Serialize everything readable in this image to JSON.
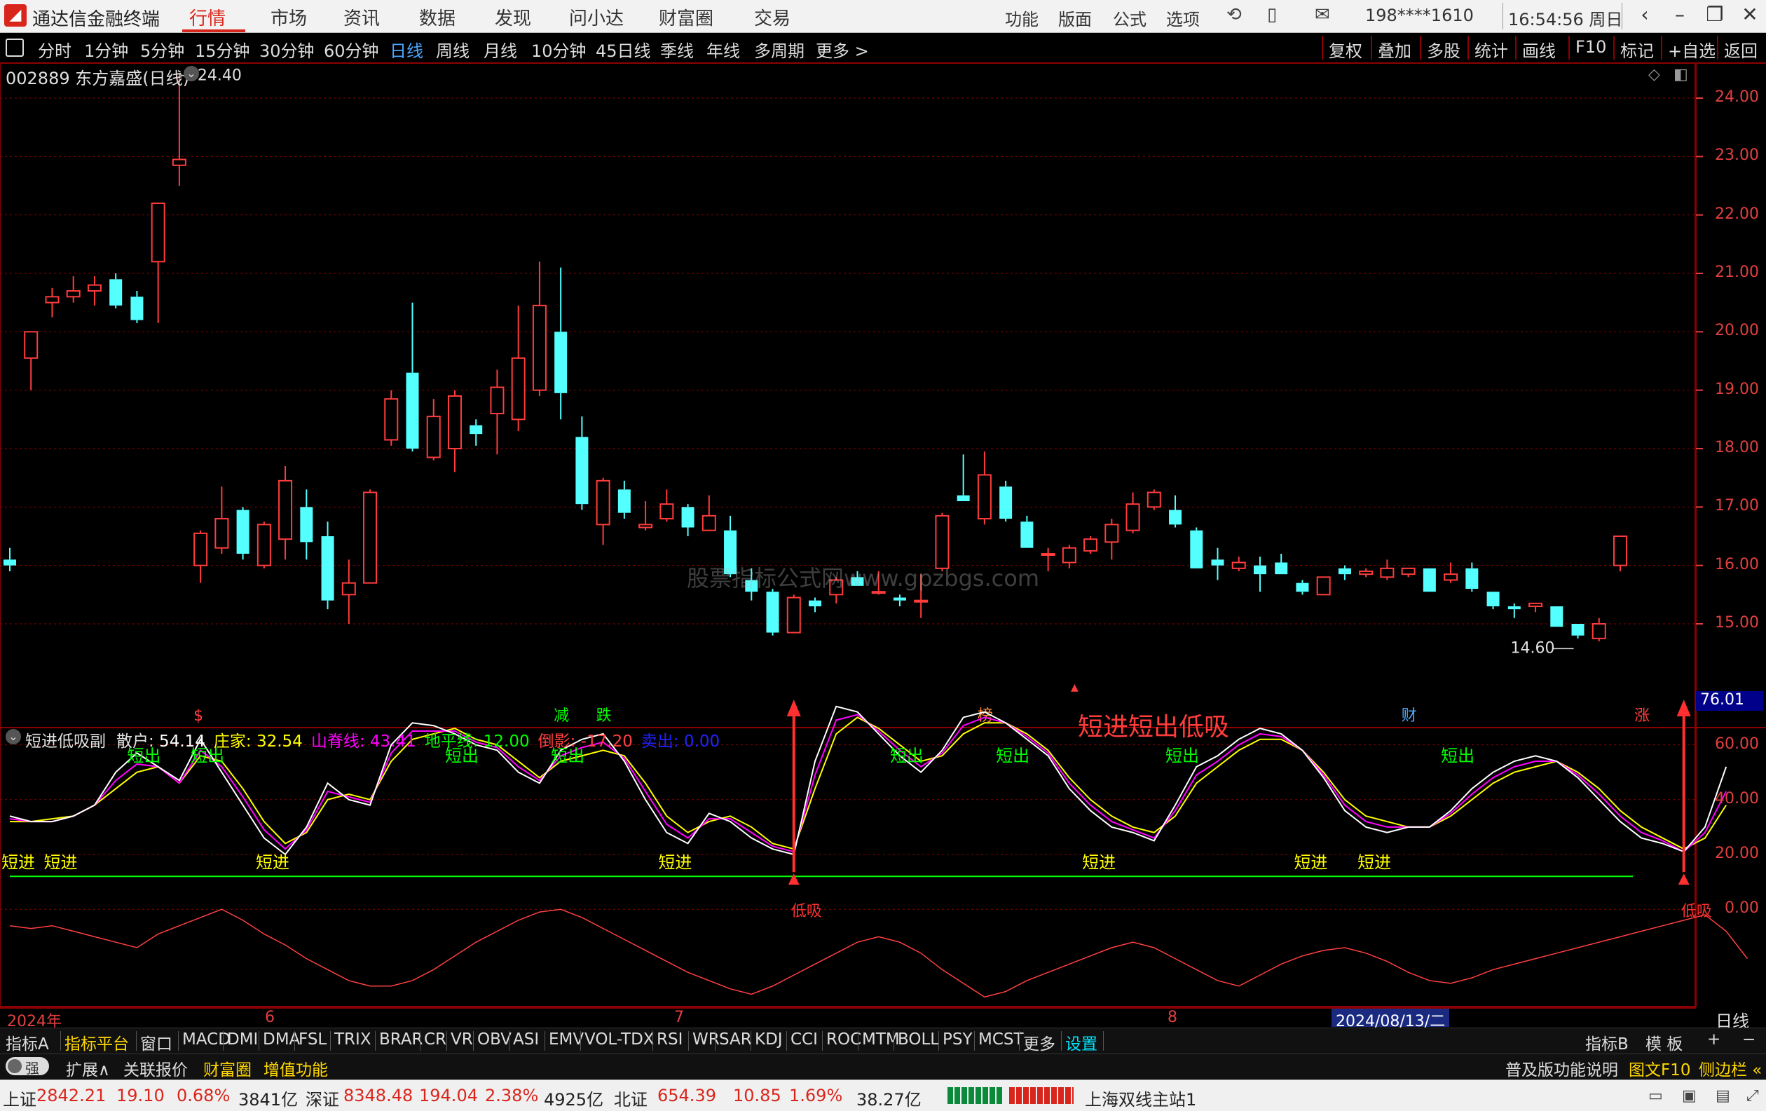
{
  "app": {
    "title": "通达信金融终端",
    "logo_icon": "tdx-logo-icon"
  },
  "menu": [
    "行情",
    "市场",
    "资讯",
    "数据",
    "发现",
    "问小达",
    "财富圈",
    "交易"
  ],
  "menu_active": "行情",
  "top_right": {
    "items": [
      "功能",
      "版面",
      "公式",
      "选项"
    ],
    "account": "198****1610",
    "clock": "16:54:56 周日"
  },
  "periods": [
    "分时",
    "1分钟",
    "5分钟",
    "15分钟",
    "30分钟",
    "60分钟",
    "日线",
    "周线",
    "月线",
    "10分钟",
    "45日线",
    "季线",
    "年线",
    "多周期",
    "更多 >"
  ],
  "period_active": "日线",
  "tools": [
    "复权",
    "叠加",
    "多股",
    "统计",
    "画线",
    "F10",
    "标记",
    "+自选",
    "返回"
  ],
  "stock": {
    "code_name": "002889 东方嘉盛(日线)",
    "high_label": "24.40",
    "low_label": "14.60"
  },
  "price_axis": [
    "24.00",
    "23.00",
    "22.00",
    "21.00",
    "20.00",
    "19.00",
    "18.00",
    "17.00",
    "16.00",
    "15.00"
  ],
  "sub_axis": [
    "60.00",
    "40.00",
    "20.00",
    "0.00"
  ],
  "sub_current": "76.01",
  "watermark": "股票指标公式网www.gpzbgs.com",
  "annotation": "短进短出低吸",
  "event_marks": [
    {
      "text": "$",
      "color": "#ff4040"
    },
    {
      "text": "减",
      "color": "#00ff00"
    },
    {
      "text": "跌",
      "color": "#00ff00"
    },
    {
      "text": "榜",
      "color": "#ff8c3c"
    },
    {
      "text": "财",
      "color": "#4da6ff"
    },
    {
      "text": "涨",
      "color": "#ff4040"
    }
  ],
  "indicator": {
    "name": "短进低吸副",
    "values": [
      {
        "label": "散户:",
        "value": "54.14",
        "color": "#ffffff"
      },
      {
        "label": "庄家:",
        "value": "32.54",
        "color": "#ffff00"
      },
      {
        "label": "山脊线:",
        "value": "43.41",
        "color": "#ff00ff"
      },
      {
        "label": "地平线:",
        "value": "12.00",
        "color": "#00ff00"
      },
      {
        "label": "倒影:",
        "value": "-17.20",
        "color": "#ff4040"
      },
      {
        "label": "卖出:",
        "value": "0.00",
        "color": "#2222ff"
      }
    ],
    "signal_in": "短进",
    "signal_out": "短出",
    "signal_low": "低吸"
  },
  "date_axis": [
    "2024年",
    "6",
    "7",
    "8"
  ],
  "date_cursor": "2024/08/13/二",
  "period_label_right": "日线",
  "indicator_tabs": [
    "指标A",
    "指标平台",
    "窗口",
    "MACD",
    "DMI",
    "DMA",
    "FSL",
    "TRIX",
    "BRAR",
    "CR",
    "VR",
    "OBV",
    "ASI",
    "EMV",
    "VOL-TDX",
    "RSI",
    "WR",
    "SAR",
    "KDJ",
    "CCI",
    "ROC",
    "MTM",
    "BOLL",
    "PSY",
    "MCST",
    "更多",
    "设置"
  ],
  "indicator_tabs_right": [
    "指标B",
    "模 板",
    "+",
    "−"
  ],
  "ext_bar": {
    "toggle": "强",
    "items": [
      "扩展∧",
      "关联报价",
      "财富圈",
      "增值功能"
    ],
    "right": [
      "普及版功能说明",
      "图文F10",
      "侧边栏 «"
    ]
  },
  "status": {
    "sh": {
      "name": "上证",
      "price": "2842.21",
      "chg": "19.10",
      "pct": "0.68%",
      "amt": "3841亿"
    },
    "sz": {
      "name": "深证",
      "price": "8348.48",
      "chg": "194.04",
      "pct": "2.38%",
      "amt": "4925亿"
    },
    "bz": {
      "name": "北证",
      "price": "654.39",
      "chg": "10.85",
      "pct": "1.69%",
      "amt": "38.27亿"
    },
    "server": "上海双线主站1"
  },
  "colors": {
    "up": "#ff3c3c",
    "down": "#54ffff",
    "grid": "#8b0000",
    "axis": "#e04040"
  },
  "chart_data": {
    "type": "candlestick",
    "title": "002889 东方嘉盛(日线)",
    "ylim": [
      14.4,
      24.6
    ],
    "candles": [
      {
        "o": 16.1,
        "h": 16.3,
        "l": 15.9,
        "c": 16.0
      },
      {
        "o": 19.55,
        "h": 19.8,
        "l": 19.0,
        "c": 20.0
      },
      {
        "o": 20.5,
        "h": 20.75,
        "l": 20.25,
        "c": 20.6
      },
      {
        "o": 20.6,
        "h": 20.95,
        "l": 20.5,
        "c": 20.7
      },
      {
        "o": 20.7,
        "h": 20.95,
        "l": 20.45,
        "c": 20.8
      },
      {
        "o": 20.9,
        "h": 21.0,
        "l": 20.4,
        "c": 20.45
      },
      {
        "o": 20.6,
        "h": 20.7,
        "l": 20.15,
        "c": 20.2
      },
      {
        "o": 21.2,
        "h": 22.2,
        "l": 20.15,
        "c": 22.2
      },
      {
        "o": 22.85,
        "h": 24.4,
        "l": 22.5,
        "c": 22.95
      },
      {
        "o": 16.0,
        "h": 16.6,
        "l": 15.7,
        "c": 16.55
      },
      {
        "o": 16.3,
        "h": 17.35,
        "l": 16.2,
        "c": 16.8
      },
      {
        "o": 16.95,
        "h": 17.0,
        "l": 16.1,
        "c": 16.2
      },
      {
        "o": 16.0,
        "h": 16.75,
        "l": 15.95,
        "c": 16.7
      },
      {
        "o": 16.45,
        "h": 17.7,
        "l": 16.1,
        "c": 17.45
      },
      {
        "o": 17.0,
        "h": 17.3,
        "l": 16.1,
        "c": 16.4
      },
      {
        "o": 16.5,
        "h": 16.75,
        "l": 15.25,
        "c": 15.4
      },
      {
        "o": 15.5,
        "h": 16.1,
        "l": 15.0,
        "c": 15.7
      },
      {
        "o": 15.7,
        "h": 17.3,
        "l": 15.7,
        "c": 17.25
      },
      {
        "o": 18.15,
        "h": 19.0,
        "l": 18.05,
        "c": 18.85
      },
      {
        "o": 19.3,
        "h": 20.5,
        "l": 17.95,
        "c": 18.0
      },
      {
        "o": 17.85,
        "h": 18.85,
        "l": 17.8,
        "c": 18.55
      },
      {
        "o": 18.0,
        "h": 19.0,
        "l": 17.6,
        "c": 18.9
      },
      {
        "o": 18.4,
        "h": 18.5,
        "l": 18.05,
        "c": 18.25
      },
      {
        "o": 18.6,
        "h": 19.35,
        "l": 17.9,
        "c": 19.05
      },
      {
        "o": 18.5,
        "h": 20.45,
        "l": 18.3,
        "c": 19.55
      },
      {
        "o": 19.0,
        "h": 21.2,
        "l": 18.9,
        "c": 20.45
      },
      {
        "o": 20.0,
        "h": 21.1,
        "l": 18.5,
        "c": 18.95
      },
      {
        "o": 18.2,
        "h": 18.55,
        "l": 16.95,
        "c": 17.05
      },
      {
        "o": 16.7,
        "h": 17.5,
        "l": 16.35,
        "c": 17.45
      },
      {
        "o": 17.3,
        "h": 17.45,
        "l": 16.8,
        "c": 16.9
      },
      {
        "o": 16.65,
        "h": 17.1,
        "l": 16.6,
        "c": 16.7
      },
      {
        "o": 16.8,
        "h": 17.3,
        "l": 16.75,
        "c": 17.05
      },
      {
        "o": 17.0,
        "h": 17.05,
        "l": 16.5,
        "c": 16.65
      },
      {
        "o": 16.6,
        "h": 17.2,
        "l": 16.6,
        "c": 16.85
      },
      {
        "o": 16.6,
        "h": 16.85,
        "l": 15.8,
        "c": 15.85
      },
      {
        "o": 15.75,
        "h": 15.95,
        "l": 15.4,
        "c": 15.55
      },
      {
        "o": 15.55,
        "h": 15.6,
        "l": 14.8,
        "c": 14.85
      },
      {
        "o": 14.85,
        "h": 15.5,
        "l": 14.85,
        "c": 15.45
      },
      {
        "o": 15.4,
        "h": 15.45,
        "l": 15.2,
        "c": 15.3
      },
      {
        "o": 15.5,
        "h": 15.8,
        "l": 15.35,
        "c": 15.75
      },
      {
        "o": 15.8,
        "h": 15.9,
        "l": 15.65,
        "c": 15.65
      },
      {
        "o": 15.55,
        "h": 15.9,
        "l": 15.5,
        "c": 15.55
      },
      {
        "o": 15.45,
        "h": 15.5,
        "l": 15.3,
        "c": 15.4
      },
      {
        "o": 15.4,
        "h": 15.85,
        "l": 15.1,
        "c": 15.4
      },
      {
        "o": 15.95,
        "h": 16.9,
        "l": 15.9,
        "c": 16.85
      },
      {
        "o": 17.2,
        "h": 17.9,
        "l": 17.1,
        "c": 17.1
      },
      {
        "o": 16.8,
        "h": 17.95,
        "l": 16.7,
        "c": 17.55
      },
      {
        "o": 17.35,
        "h": 17.45,
        "l": 16.75,
        "c": 16.8
      },
      {
        "o": 16.75,
        "h": 16.85,
        "l": 16.3,
        "c": 16.3
      },
      {
        "o": 16.2,
        "h": 16.3,
        "l": 15.9,
        "c": 16.2
      },
      {
        "o": 16.05,
        "h": 16.35,
        "l": 15.95,
        "c": 16.3
      },
      {
        "o": 16.25,
        "h": 16.5,
        "l": 16.2,
        "c": 16.45
      },
      {
        "o": 16.4,
        "h": 16.8,
        "l": 16.1,
        "c": 16.7
      },
      {
        "o": 16.6,
        "h": 17.25,
        "l": 16.55,
        "c": 17.05
      },
      {
        "o": 17.0,
        "h": 17.3,
        "l": 16.95,
        "c": 17.25
      },
      {
        "o": 16.95,
        "h": 17.2,
        "l": 16.65,
        "c": 16.7
      },
      {
        "o": 16.6,
        "h": 16.65,
        "l": 15.95,
        "c": 15.95
      },
      {
        "o": 16.1,
        "h": 16.3,
        "l": 15.75,
        "c": 16.0
      },
      {
        "o": 15.95,
        "h": 16.15,
        "l": 15.9,
        "c": 16.05
      },
      {
        "o": 16.0,
        "h": 16.15,
        "l": 15.55,
        "c": 15.85
      },
      {
        "o": 16.05,
        "h": 16.2,
        "l": 15.85,
        "c": 15.85
      },
      {
        "o": 15.7,
        "h": 15.75,
        "l": 15.5,
        "c": 15.55
      },
      {
        "o": 15.5,
        "h": 15.8,
        "l": 15.5,
        "c": 15.8
      },
      {
        "o": 15.95,
        "h": 16.0,
        "l": 15.75,
        "c": 15.85
      },
      {
        "o": 15.85,
        "h": 15.95,
        "l": 15.8,
        "c": 15.9
      },
      {
        "o": 15.8,
        "h": 16.1,
        "l": 15.75,
        "c": 15.95
      },
      {
        "o": 15.85,
        "h": 15.95,
        "l": 15.8,
        "c": 15.95
      },
      {
        "o": 15.95,
        "h": 15.95,
        "l": 15.55,
        "c": 15.55
      },
      {
        "o": 15.75,
        "h": 16.05,
        "l": 15.7,
        "c": 15.85
      },
      {
        "o": 15.95,
        "h": 16.05,
        "l": 15.55,
        "c": 15.6
      },
      {
        "o": 15.55,
        "h": 15.55,
        "l": 15.25,
        "c": 15.3
      },
      {
        "o": 15.3,
        "h": 15.35,
        "l": 15.1,
        "c": 15.25
      },
      {
        "o": 15.3,
        "h": 15.35,
        "l": 15.2,
        "c": 15.35
      },
      {
        "o": 15.3,
        "h": 15.3,
        "l": 14.95,
        "c": 14.95
      },
      {
        "o": 15.0,
        "h": 15.0,
        "l": 14.75,
        "c": 14.8
      },
      {
        "o": 14.75,
        "h": 15.1,
        "l": 14.7,
        "c": 15.0
      },
      {
        "o": 16.0,
        "h": 16.5,
        "l": 15.9,
        "c": 16.5
      }
    ],
    "sub": {
      "ylim": [
        -14,
        76
      ],
      "retail": [
        34,
        32,
        32,
        34,
        38,
        50,
        57,
        52,
        47,
        62,
        50,
        38,
        26,
        20,
        30,
        46,
        40,
        38,
        60,
        68,
        67,
        64,
        60,
        58,
        50,
        46,
        58,
        62,
        64,
        54,
        40,
        28,
        24,
        35,
        32,
        26,
        22,
        20,
        54,
        74,
        72,
        64,
        56,
        50,
        58,
        70,
        72,
        68,
        62,
        56,
        44,
        36,
        30,
        28,
        25,
        38,
        52,
        56,
        62,
        66,
        64,
        58,
        48,
        36,
        30,
        28,
        30,
        30,
        36,
        44,
        50,
        54,
        56,
        54,
        48,
        40,
        32,
        26,
        24,
        21,
        30,
        52
      ],
      "whale": [
        32,
        32,
        33,
        34,
        38,
        44,
        50,
        52,
        46,
        56,
        54,
        44,
        32,
        24,
        28,
        40,
        42,
        40,
        54,
        62,
        64,
        66,
        62,
        60,
        54,
        48,
        54,
        56,
        58,
        56,
        46,
        34,
        28,
        32,
        34,
        30,
        24,
        22,
        44,
        64,
        70,
        66,
        60,
        54,
        56,
        64,
        68,
        68,
        64,
        58,
        48,
        40,
        34,
        30,
        28,
        34,
        46,
        52,
        58,
        62,
        62,
        58,
        50,
        40,
        34,
        32,
        30,
        30,
        34,
        40,
        46,
        50,
        52,
        54,
        50,
        44,
        36,
        30,
        26,
        22,
        26,
        38
      ],
      "ridge": [
        33,
        32,
        32,
        34,
        38,
        47,
        53,
        52,
        46,
        58,
        52,
        41,
        29,
        22,
        29,
        43,
        41,
        39,
        57,
        65,
        65,
        65,
        61,
        59,
        52,
        47,
        56,
        59,
        61,
        55,
        43,
        31,
        26,
        33,
        33,
        28,
        23,
        21,
        49,
        69,
        71,
        65,
        58,
        52,
        57,
        67,
        70,
        68,
        63,
        57,
        46,
        38,
        32,
        29,
        26,
        36,
        49,
        54,
        60,
        64,
        63,
        58,
        49,
        38,
        32,
        30,
        30,
        30,
        35,
        42,
        48,
        52,
        54,
        54,
        49,
        42,
        34,
        28,
        25,
        21,
        28,
        43
      ],
      "horizon": 12.0,
      "reflection": [
        -6,
        -7,
        -6,
        -8,
        -10,
        -12,
        -14,
        -9,
        -6,
        -3,
        0,
        -4,
        -9,
        -13,
        -18,
        -22,
        -26,
        -28,
        -28,
        -26,
        -22,
        -17,
        -12,
        -8,
        -4,
        -1,
        0,
        -3,
        -7,
        -11,
        -15,
        -19,
        -23,
        -26,
        -29,
        -31,
        -28,
        -24,
        -20,
        -16,
        -12,
        -10,
        -12,
        -16,
        -22,
        -27,
        -32,
        -30,
        -26,
        -23,
        -20,
        -17,
        -14,
        -12,
        -14,
        -18,
        -22,
        -26,
        -28,
        -24,
        -20,
        -17,
        -15,
        -14,
        -16,
        -19,
        -23,
        -26,
        -27,
        -25,
        -22,
        -20,
        -18,
        -16,
        -14,
        -12,
        -10,
        -8,
        -6,
        -4,
        -2,
        -8,
        -18
      ]
    },
    "signals_in_at": [
      0,
      2,
      12,
      31,
      51,
      61,
      64
    ],
    "signals_out_at": [
      6,
      9,
      21,
      26,
      42,
      47,
      55,
      68
    ],
    "low_buy_at": [
      37,
      79
    ]
  }
}
